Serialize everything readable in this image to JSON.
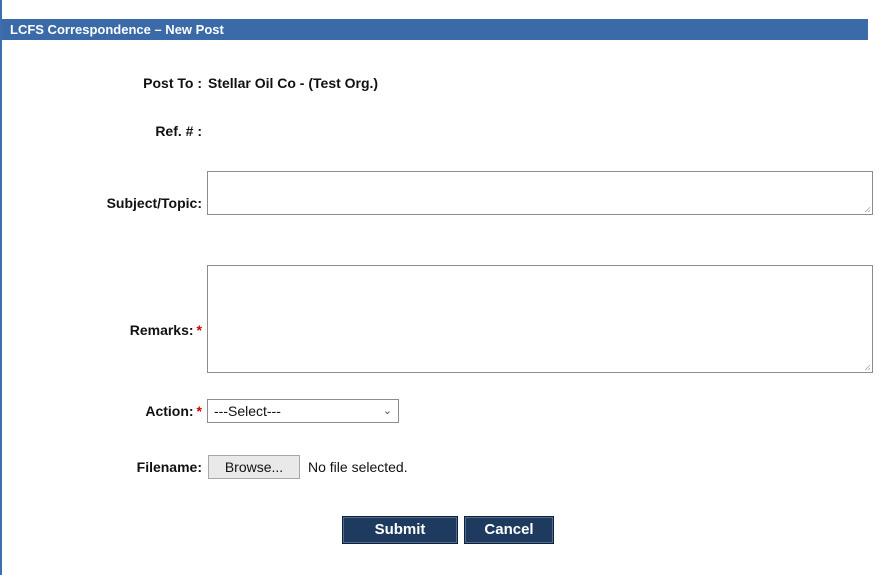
{
  "window": {
    "title": "LCFS Correspondence – New Post"
  },
  "form": {
    "post_to": {
      "label": "Post To :",
      "value": "Stellar Oil Co - (Test Org.)"
    },
    "ref": {
      "label": "Ref. # :",
      "value": ""
    },
    "subject": {
      "label": "Subject/Topic:",
      "value": ""
    },
    "remarks": {
      "label": "Remarks:",
      "required_marker": "*",
      "value": ""
    },
    "action": {
      "label": "Action:",
      "required_marker": "*",
      "selected": "---Select---"
    },
    "filename": {
      "label": "Filename:",
      "browse_label": "Browse...",
      "status": "No file selected."
    }
  },
  "buttons": {
    "submit_label": "Submit",
    "cancel_label": "Cancel"
  },
  "colors": {
    "title_bar": "#3a6aa8",
    "button_bg": "#1f3a5f",
    "required": "#cc0000"
  },
  "icons": {
    "dropdown": "chevron-down-icon",
    "resize": "resize-grip-icon"
  }
}
